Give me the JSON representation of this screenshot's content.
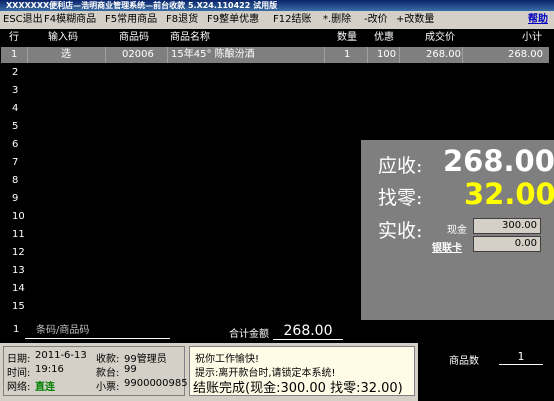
{
  "window": {
    "title": "XXXXXXX便利店—浩明商业管理系统—前台收款 5.X24.110422 试用版"
  },
  "menubar": {
    "items": [
      "ESC退出",
      "F4模糊商品",
      "F5常用商品",
      "F8退货",
      "F9整单优惠",
      "F12结账",
      "*.删除",
      "-改价",
      "+改数量"
    ],
    "help": "帮助"
  },
  "grid": {
    "headers": [
      "行",
      "输入码",
      "商品码",
      "商品名称",
      "数量",
      "优惠",
      "成交价",
      "小计"
    ],
    "rows": [
      {
        "line": "1",
        "input_code": "选",
        "product_code": "02006",
        "name": "15年45° 陈酿汾酒",
        "qty": "1",
        "discount": "100",
        "price": "268.00",
        "subtotal": "268.00"
      }
    ],
    "row_numbers": [
      "1",
      "2",
      "3",
      "4",
      "5",
      "6",
      "7",
      "8",
      "9",
      "10",
      "11",
      "12",
      "13",
      "14",
      "15"
    ]
  },
  "summary": {
    "receivable_label": "应收:",
    "receivable_value": "268.00",
    "change_label": "找零:",
    "change_value": "32.00",
    "received_label": "实收:",
    "cash_label": "现金",
    "cash_value": "300.00",
    "card_label": "银联卡",
    "card_value": "0.00",
    "colors": {
      "receivable": "#ffffff",
      "change": "#ffff00"
    }
  },
  "input": {
    "qty": "1",
    "placeholder": "条码/商品码",
    "total_label": "合计金额",
    "total_value": "268.00"
  },
  "status": {
    "date_label": "日期:",
    "date_value": "2011-6-13",
    "time_label": "时间:",
    "time_value": "19:16",
    "network_label": "网络:",
    "network_value": "直连",
    "cashier_label": "收款:",
    "cashier_value": "99管理员",
    "register_label": "款台:",
    "register_value": "99",
    "ticket_label": "小票:",
    "ticket_value": "9900000985",
    "msg1": "祝你工作愉快!",
    "msg2": "提示:离开款台时,请锁定本系统!",
    "finish_text": "结账完成(现金:300.00  找零:32.00)",
    "count_label": "商品数",
    "count_value": "1"
  }
}
